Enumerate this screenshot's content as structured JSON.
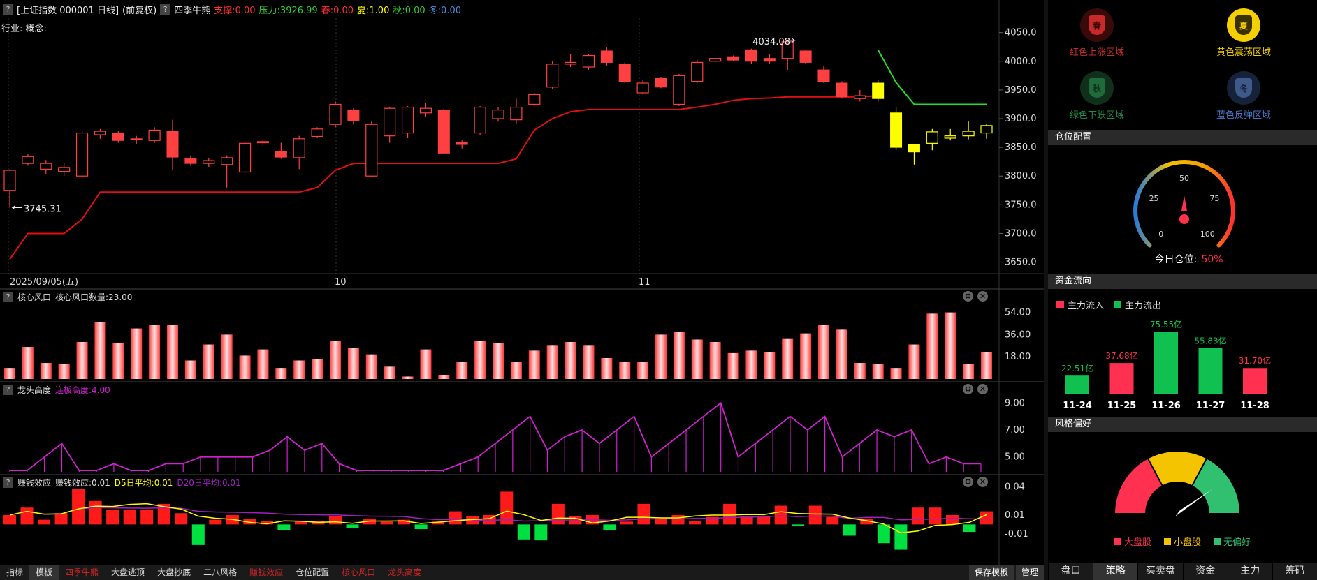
{
  "header": {
    "title": "[上证指数 000001 日线]",
    "adj": "(前复权)",
    "indicator_name": "四季牛熊",
    "support_label": "支撑:0.00",
    "pressure_label": "压力:3926.99",
    "spring_label": "春:0.00",
    "summer_label": "夏:1.00",
    "autumn_label": "秋:0.00",
    "winter_label": "冬:0.00",
    "industry": "行业: 概念:"
  },
  "price_axis": [
    "4050.0",
    "4000.0",
    "3950.0",
    "3900.0",
    "3850.0",
    "3800.0",
    "3750.0",
    "3700.0",
    "3650.0"
  ],
  "date_labels": {
    "start": "2025/09/05(五)",
    "oct": "10",
    "nov": "11"
  },
  "annotations": {
    "high": "4034.08",
    "low": "3745.31"
  },
  "pane_core": {
    "title": "核心风口",
    "value": "核心风口数量:23.00",
    "axis": [
      "54.00",
      "36.00",
      "18.00"
    ]
  },
  "pane_dragon": {
    "title": "龙头高度",
    "value": "连板高度:4.00",
    "axis": [
      "9.00",
      "7.00",
      "5.00"
    ]
  },
  "pane_money": {
    "title": "赚钱效应",
    "value": "赚钱效应:0.01",
    "d5": "D5日平均:0.01",
    "d20": "D20日平均:0.01",
    "axis": [
      "0.04",
      "0.01",
      "-0.01"
    ]
  },
  "bottom_tabs": [
    "指标",
    "模板",
    "四季牛熊",
    "大盘逃顶",
    "大盘抄底",
    "二八风格",
    "赚钱效应",
    "仓位配置",
    "核心风口",
    "龙头高度"
  ],
  "bottom_buttons": [
    "保存模板",
    "管理"
  ],
  "seasons": [
    {
      "char": "春",
      "label": "红色上涨区域",
      "color": "#c82a2a"
    },
    {
      "char": "夏",
      "label": "黄色震荡区域",
      "color": "#f5d000"
    },
    {
      "char": "秋",
      "label": "绿色下跌区域",
      "color": "#1f6b3a"
    },
    {
      "char": "冬",
      "label": "蓝色反弹区域",
      "color": "#3d5a8a"
    }
  ],
  "position": {
    "title": "仓位配置",
    "ticks": [
      "0",
      "25",
      "50",
      "75",
      "100"
    ],
    "label": "今日仓位:",
    "value": "50%",
    "percent": 50
  },
  "fund_flow": {
    "title": "资金流向",
    "legend_in": "主力流入",
    "legend_out": "主力流出",
    "bars": [
      {
        "date": "11-24",
        "value": 22.51,
        "label": "22.51亿",
        "dir": "out"
      },
      {
        "date": "11-25",
        "value": 37.68,
        "label": "37.68亿",
        "dir": "in"
      },
      {
        "date": "11-26",
        "value": 75.55,
        "label": "75.55亿",
        "dir": "out"
      },
      {
        "date": "11-27",
        "value": 55.83,
        "label": "55.83亿",
        "dir": "out"
      },
      {
        "date": "11-28",
        "value": 31.7,
        "label": "31.70亿",
        "dir": "in"
      }
    ]
  },
  "style": {
    "title": "风格偏好",
    "legend": [
      "大盘股",
      "小盘股",
      "无偏好"
    ]
  },
  "right_tabs": [
    "盘口",
    "策略",
    "买卖盘",
    "资金",
    "主力",
    "筹码"
  ],
  "colors": {
    "up": "#ff4040",
    "down": "#00d060",
    "yellow": "#ffff00",
    "magenta": "#d020d0",
    "line_red": "#e01010"
  },
  "chart_data": {
    "candles": [
      [
        3775,
        3810,
        3745,
        3812
      ],
      [
        3822,
        3834,
        3818,
        3838
      ],
      [
        3812,
        3822,
        3803,
        3828
      ],
      [
        3808,
        3815,
        3800,
        3822
      ],
      [
        3800,
        3875,
        3797,
        3878
      ],
      [
        3872,
        3878,
        3865,
        3882
      ],
      [
        3875,
        3862,
        3858,
        3878
      ],
      [
        3865,
        3863,
        3855,
        3870
      ],
      [
        3862,
        3880,
        3858,
        3885
      ],
      [
        3878,
        3833,
        3810,
        3898
      ],
      [
        3830,
        3822,
        3818,
        3836
      ],
      [
        3822,
        3827,
        3816,
        3832
      ],
      [
        3820,
        3832,
        3780,
        3836
      ],
      [
        3807,
        3857,
        3805,
        3860
      ],
      [
        3858,
        3860,
        3852,
        3865
      ],
      [
        3843,
        3833,
        3830,
        3858
      ],
      [
        3832,
        3865,
        3812,
        3870
      ],
      [
        3869,
        3882,
        3866,
        3885
      ],
      [
        3890,
        3925,
        3885,
        3930
      ],
      [
        3915,
        3897,
        3890,
        3918
      ],
      [
        3800,
        3890,
        3799,
        3895
      ],
      [
        3870,
        3918,
        3858,
        3920
      ],
      [
        3875,
        3920,
        3866,
        3922
      ],
      [
        3910,
        3918,
        3903,
        3928
      ],
      [
        3915,
        3840,
        3838,
        3918
      ],
      [
        3858,
        3855,
        3848,
        3862
      ],
      [
        3875,
        3920,
        3872,
        3922
      ],
      [
        3900,
        3915,
        3895,
        3920
      ],
      [
        3898,
        3920,
        3890,
        3935
      ],
      [
        3925,
        3942,
        3922,
        3945
      ],
      [
        3955,
        3995,
        3952,
        4000
      ],
      [
        3995,
        3998,
        3990,
        4012
      ],
      [
        3990,
        4010,
        3985,
        4012
      ],
      [
        4018,
        3998,
        3992,
        4025
      ],
      [
        3995,
        3965,
        3962,
        3998
      ],
      [
        3945,
        3962,
        3942,
        3968
      ],
      [
        3970,
        3955,
        3953,
        3972
      ],
      [
        3925,
        3975,
        3922,
        3978
      ],
      [
        3965,
        3998,
        3962,
        4003
      ],
      [
        4000,
        4005,
        3998,
        4006
      ],
      [
        4008,
        4002,
        4000,
        4010
      ],
      [
        4020,
        4000,
        3995,
        4022
      ],
      [
        4005,
        4000,
        3995,
        4012
      ],
      [
        4005,
        4034,
        3985,
        4034
      ],
      [
        4018,
        3998,
        3995,
        4020
      ],
      [
        3985,
        3965,
        3962,
        3992
      ],
      [
        3962,
        3938,
        3935,
        3965
      ],
      [
        3935,
        3940,
        3930,
        3950
      ],
      [
        3962,
        3935,
        3930,
        3968
      ],
      [
        3910,
        3850,
        3845,
        3920
      ],
      [
        3855,
        3842,
        3820,
        3855
      ],
      [
        3857,
        3877,
        3845,
        3882
      ],
      [
        3866,
        3870,
        3862,
        3882
      ],
      [
        3870,
        3878,
        3864,
        3895
      ],
      [
        3875,
        3888,
        3865,
        3890
      ]
    ],
    "red_line": [
      3655,
      3700,
      3700,
      3700,
      3725,
      3772,
      3772,
      3772,
      3772,
      3772,
      3772,
      3772,
      3772,
      3772,
      3772,
      3772,
      3772,
      3780,
      3810,
      3822,
      3822,
      3822,
      3822,
      3822,
      3822,
      3822,
      3822,
      3822,
      3830,
      3880,
      3900,
      3912,
      3916,
      3916,
      3916,
      3916,
      3916,
      3916,
      3920,
      3925,
      3932,
      3935,
      3936,
      3938,
      3938,
      3938,
      3938,
      3938,
      3940
    ],
    "green_line": [
      4020,
      3963,
      3925,
      3925,
      3925,
      3925,
      3925
    ],
    "core_wind": [
      9,
      26,
      13,
      12,
      30,
      46,
      29,
      41,
      44,
      44,
      15,
      28,
      36,
      19,
      24,
      9,
      15,
      16,
      31,
      25,
      20,
      10,
      2,
      24,
      3,
      14,
      31,
      29,
      14,
      23,
      27,
      30,
      27,
      17,
      14,
      14,
      36,
      38,
      32,
      30,
      21,
      23,
      22,
      33,
      37,
      44,
      40,
      13,
      12,
      9,
      28,
      53,
      54,
      12,
      22
    ],
    "dragon_height": [
      4,
      4,
      5,
      6,
      4,
      4,
      4.5,
      4,
      4,
      4.5,
      4.5,
      5,
      5,
      5,
      5,
      5.5,
      6.5,
      5.5,
      6,
      4.5,
      4,
      4,
      4,
      4,
      4,
      4,
      4.5,
      5,
      6,
      7,
      8,
      5.5,
      6.5,
      7,
      6,
      7,
      8,
      5,
      6,
      7,
      8,
      9,
      5,
      6,
      7,
      8,
      7,
      8,
      5,
      6,
      7,
      6.5,
      7,
      4.5,
      5,
      4.5,
      4.5
    ],
    "money_effect": [
      0.01,
      0.018,
      0.005,
      0.012,
      0.038,
      0.025,
      0.016,
      0.016,
      0.016,
      0.022,
      0.012,
      -0.022,
      0.005,
      0.01,
      0.006,
      0.004,
      -0.006,
      0.003,
      0.004,
      0.009,
      -0.004,
      0.006,
      0.003,
      0.005,
      -0.005,
      0.003,
      0.014,
      0.009,
      0.01,
      0.035,
      -0.016,
      -0.017,
      0.022,
      0.009,
      0.01,
      -0.006,
      0.003,
      0.022,
      0.006,
      0.01,
      0.004,
      0.008,
      0.022,
      0.009,
      0.009,
      0.02,
      -0.002,
      0.02,
      0.008,
      -0.012,
      0.006,
      -0.02,
      -0.027,
      0.018,
      0.018,
      0.01,
      -0.008,
      0.014
    ]
  }
}
